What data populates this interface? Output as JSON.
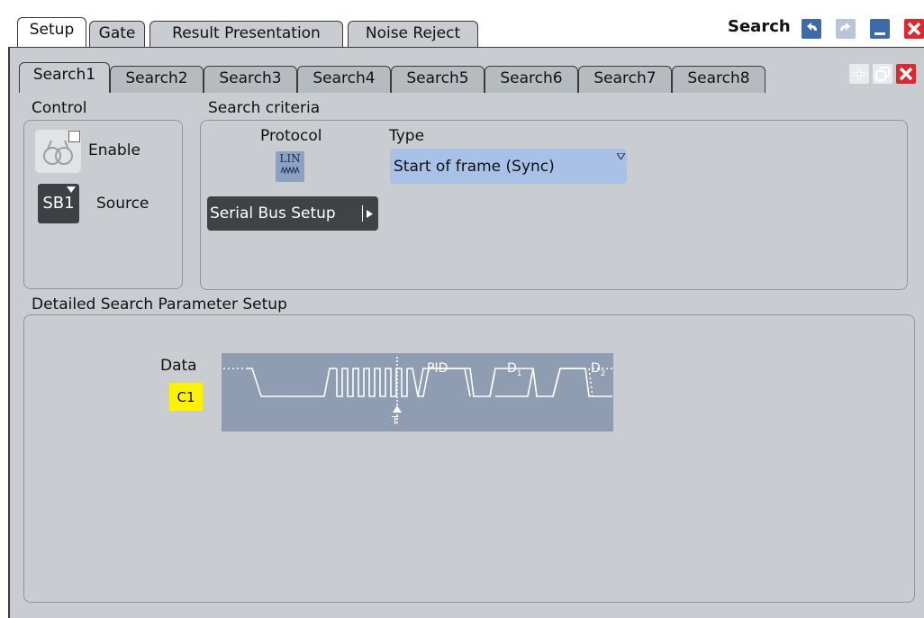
{
  "title": "Search",
  "tabs": [
    "Setup",
    "Gate",
    "Result Presentation",
    "Noise Reject"
  ],
  "search_tabs": [
    "Search1",
    "Search2",
    "Search3",
    "Search4",
    "Search5",
    "Search6",
    "Search7",
    "Search8"
  ],
  "control": {
    "heading": "Control",
    "enable_label": "Enable",
    "enable_checked": false,
    "source_label": "Source",
    "source_value": "SB1"
  },
  "criteria": {
    "heading": "Search criteria",
    "protocol_label": "Protocol",
    "protocol_icon_text": "LIN",
    "serial_bus_button": "Serial Bus Setup",
    "type_label": "Type",
    "type_value": "Start of frame (Sync)"
  },
  "detail": {
    "heading": "Detailed Search Parameter Setup",
    "data_label": "Data",
    "channel": "C1",
    "fields": [
      "PID",
      "D",
      "D"
    ],
    "field_subs": [
      "",
      "1",
      "2"
    ],
    "trigger_marker": "T"
  },
  "colors": {
    "panel_bg": "#c9cdd1",
    "dropdown_bg": "#a9c1e6",
    "button_dark": "#404244",
    "channel_badge": "#fff200",
    "diagram_bg": "#8f9db2",
    "close_red": "#e0262e"
  }
}
